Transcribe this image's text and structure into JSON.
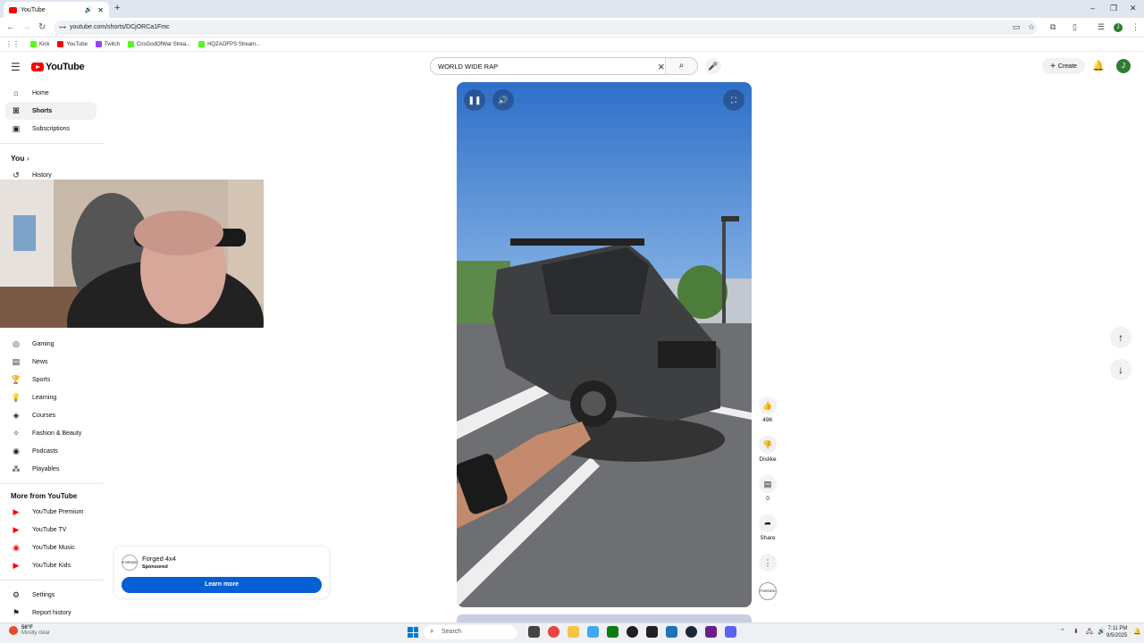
{
  "browser": {
    "tab_title": "YouTube",
    "url": "youtube.com/shorts/DCjORCa1Fmc",
    "bookmarks": [
      "Kick",
      "YouTube",
      "Twitch",
      "CrisGodOfWar Strea...",
      "HQZAOFPS Stream..."
    ],
    "avatar_initial": "J"
  },
  "youtube": {
    "logo_text": "YouTube",
    "search_value": "WORLD WIDE RAP",
    "create_label": "Create",
    "avatar_initial": "J"
  },
  "sidebar": {
    "items": [
      {
        "label": "Home",
        "icon": "home-icon"
      },
      {
        "label": "Shorts",
        "icon": "shorts-icon"
      },
      {
        "label": "Subscriptions",
        "icon": "subscriptions-icon"
      }
    ],
    "you_label": "You",
    "history_label": "History",
    "explore": [
      {
        "label": "Gaming",
        "icon": "gaming-icon"
      },
      {
        "label": "News",
        "icon": "news-icon"
      },
      {
        "label": "Sports",
        "icon": "sports-icon"
      },
      {
        "label": "Learning",
        "icon": "learning-icon"
      },
      {
        "label": "Courses",
        "icon": "courses-icon"
      },
      {
        "label": "Fashion & Beauty",
        "icon": "fashion-icon"
      },
      {
        "label": "Podcasts",
        "icon": "podcasts-icon"
      },
      {
        "label": "Playables",
        "icon": "playables-icon"
      }
    ],
    "more_title": "More from YouTube",
    "more": [
      "YouTube Premium",
      "YouTube TV",
      "YouTube Music",
      "YouTube Kids"
    ],
    "settings": "Settings",
    "report_history": "Report history"
  },
  "ad": {
    "channel": "Forged 4x4",
    "sponsored": "Sponsored",
    "cta": "Learn more",
    "logo_text": "FORGED"
  },
  "short": {
    "likes": "49K",
    "dislike_label": "Dislike",
    "comments": "0",
    "share_label": "Share"
  },
  "taskbar": {
    "temperature": "56°F",
    "weather": "Mostly clear",
    "search_placeholder": "Search",
    "time": "7:11 PM",
    "date": "9/5/2025"
  },
  "colors": {
    "youtube_red": "#ff0000",
    "cta_blue": "#065fd4",
    "sky_blue": "#3d7fd4"
  }
}
